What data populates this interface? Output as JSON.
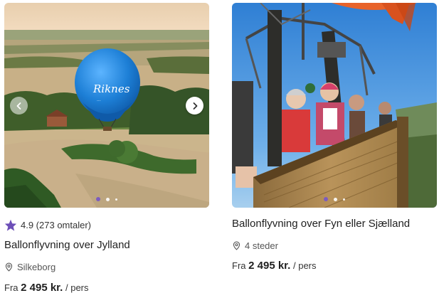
{
  "cards": [
    {
      "rating_score": "4.9 (273 omtaler)",
      "title": "Ballonflyvning over Jylland",
      "location": "Silkeborg",
      "price_prefix": "Fra",
      "price_amount": "2 495 kr.",
      "price_suffix": "/ pers",
      "balloon_text": "Riknes",
      "balloon_subtext": "...",
      "slide_count": 3,
      "active_slide": 1,
      "icons": {
        "rating": "star-icon",
        "location": "location-pin-icon",
        "prev": "chevron-left-icon",
        "next": "chevron-right-icon"
      }
    },
    {
      "title": "Ballonflyvning over Fyn eller Sjælland",
      "location": "4 steder",
      "price_prefix": "Fra",
      "price_amount": "2 495 kr.",
      "price_suffix": "/ pers",
      "slide_count": 3,
      "active_slide": 1,
      "icons": {
        "location": "location-pin-icon"
      }
    }
  ],
  "colors": {
    "accent": "#7c5cbf",
    "balloon_blue": "#1d7fd6",
    "sky": "#3d8ad8"
  }
}
